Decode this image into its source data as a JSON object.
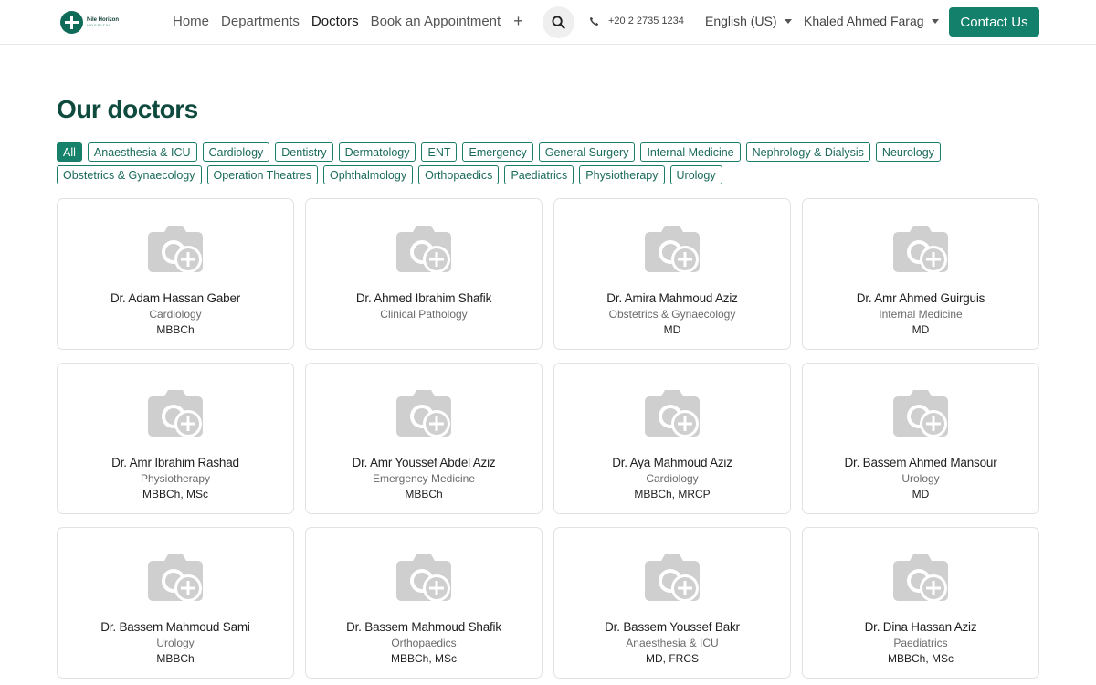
{
  "header": {
    "logo": {
      "name": "Nile Horizon",
      "sub": "HOSPITAL"
    },
    "nav": [
      "Home",
      "Departments",
      "Doctors",
      "Book an Appointment"
    ],
    "active_nav": "Doctors",
    "phone": "+20 2 2735 1234",
    "language": "English (US)",
    "user": "Khaled Ahmed Farag",
    "contact": "Contact Us"
  },
  "page": {
    "title": "Our doctors"
  },
  "filters": {
    "row1": [
      "All",
      "Anaesthesia & ICU",
      "Cardiology",
      "Dentistry",
      "Dermatology",
      "ENT",
      "Emergency",
      "General Surgery",
      "Internal Medicine",
      "Nephrology & Dialysis",
      "Neurology"
    ],
    "row2": [
      "Obstetrics & Gynaecology",
      "Operation Theatres",
      "Ophthalmology",
      "Orthopaedics",
      "Paediatrics",
      "Physiotherapy",
      "Urology"
    ],
    "active": "All"
  },
  "doctors": [
    {
      "name": "Dr. Adam Hassan Gaber",
      "dept": "Cardiology",
      "degree": "MBBCh"
    },
    {
      "name": "Dr. Ahmed Ibrahim Shafik",
      "dept": "Clinical Pathology",
      "degree": ""
    },
    {
      "name": "Dr. Amira Mahmoud Aziz",
      "dept": "Obstetrics & Gynaecology",
      "degree": "MD"
    },
    {
      "name": "Dr. Amr Ahmed Guirguis",
      "dept": "Internal Medicine",
      "degree": "MD"
    },
    {
      "name": "Dr. Amr Ibrahim Rashad",
      "dept": "Physiotherapy",
      "degree": "MBBCh, MSc"
    },
    {
      "name": "Dr. Amr Youssef Abdel Aziz",
      "dept": "Emergency Medicine",
      "degree": "MBBCh"
    },
    {
      "name": "Dr. Aya Mahmoud Aziz",
      "dept": "Cardiology",
      "degree": "MBBCh, MRCP"
    },
    {
      "name": "Dr. Bassem Ahmed Mansour",
      "dept": "Urology",
      "degree": "MD"
    },
    {
      "name": "Dr. Bassem Mahmoud Sami",
      "dept": "Urology",
      "degree": "MBBCh"
    },
    {
      "name": "Dr. Bassem Mahmoud Shafik",
      "dept": "Orthopaedics",
      "degree": "MBBCh, MSc"
    },
    {
      "name": "Dr. Bassem Youssef Bakr",
      "dept": "Anaesthesia & ICU",
      "degree": "MD, FRCS"
    },
    {
      "name": "Dr. Dina Hassan Aziz",
      "dept": "Paediatrics",
      "degree": "MBBCh, MSc"
    }
  ],
  "colors": {
    "brand": "#12806a",
    "title": "#0e4a3d",
    "chip_border": "#1a7d68"
  },
  "icons": {
    "photo_placeholder": "camera-add-icon",
    "search": "search-icon",
    "phone": "phone-icon",
    "add": "plus-icon"
  }
}
